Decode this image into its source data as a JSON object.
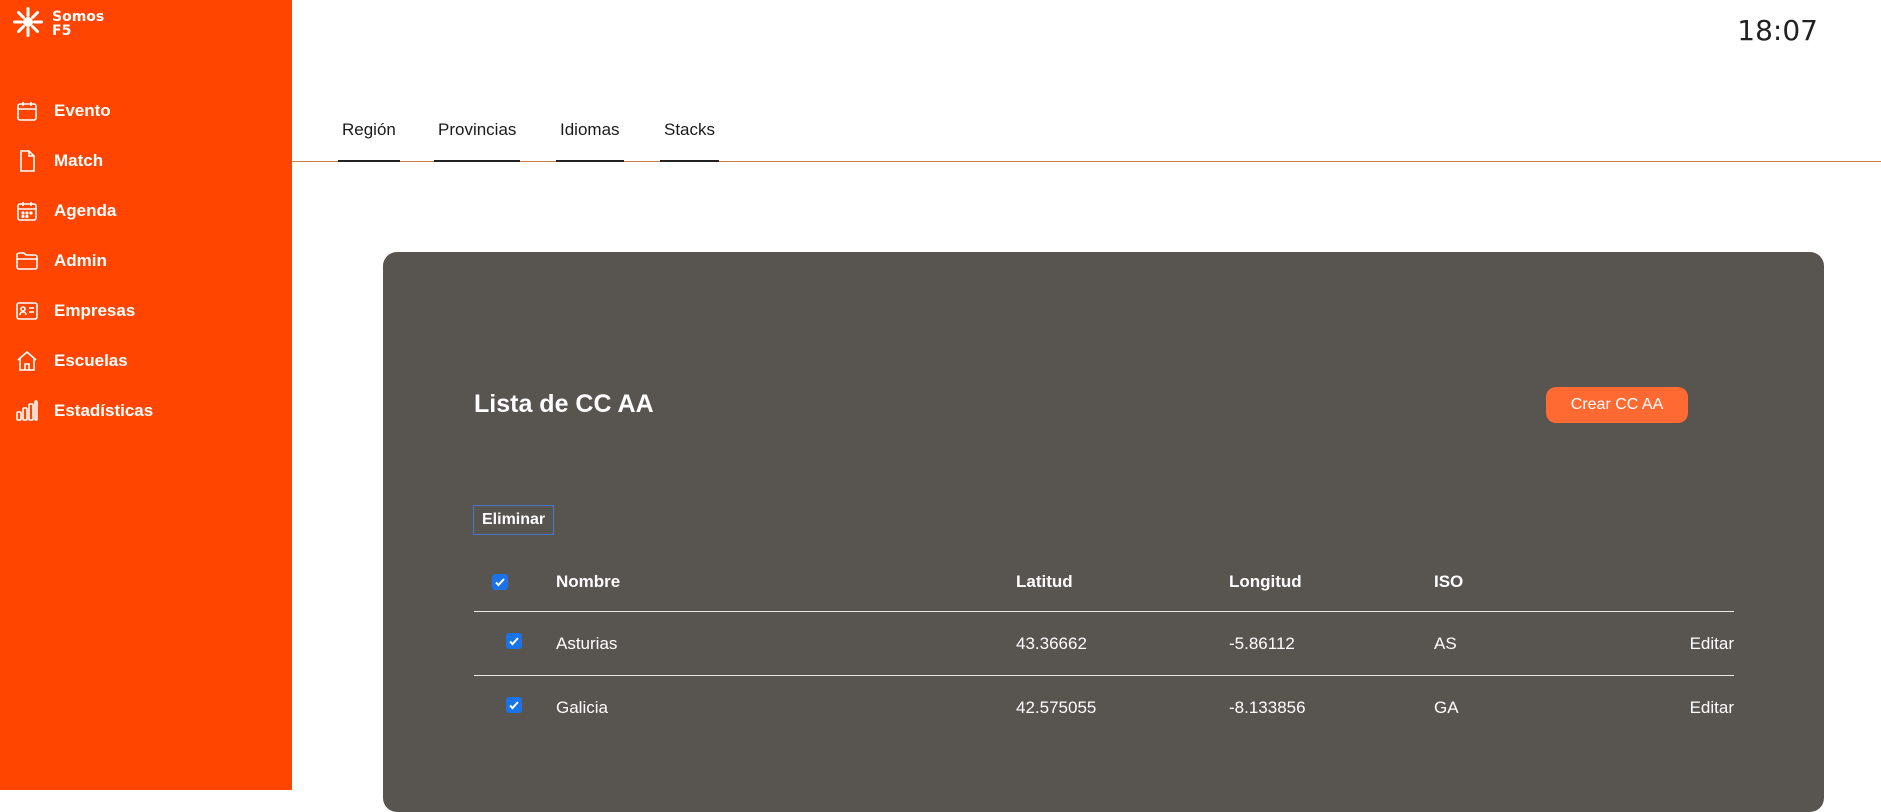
{
  "brand": {
    "line1": "Somos",
    "line2": "F5"
  },
  "sidebar": {
    "items": [
      {
        "label": "Evento",
        "icon": "calendar-icon"
      },
      {
        "label": "Match",
        "icon": "file-icon"
      },
      {
        "label": "Agenda",
        "icon": "calendar-grid-icon"
      },
      {
        "label": "Admin",
        "icon": "folder-icon"
      },
      {
        "label": "Empresas",
        "icon": "id-card-icon"
      },
      {
        "label": "Escuelas",
        "icon": "home-icon"
      },
      {
        "label": "Estadísticas",
        "icon": "bar-chart-icon"
      }
    ]
  },
  "header": {
    "time": "18:07"
  },
  "tabs": [
    {
      "label": "Región"
    },
    {
      "label": "Provincias"
    },
    {
      "label": "Idiomas"
    },
    {
      "label": "Stacks"
    }
  ],
  "panel": {
    "title": "Lista de CC AA",
    "create_label": "Crear CC AA",
    "delete_label": "Eliminar"
  },
  "table": {
    "columns": [
      "Nombre",
      "Latitud",
      "Longitud",
      "ISO"
    ],
    "edit_label": "Editar",
    "rows": [
      {
        "name": "Asturias",
        "lat": "43.36662",
        "lon": "-5.86112",
        "iso": "AS",
        "checked": true
      },
      {
        "name": "Galicia",
        "lat": "42.575055",
        "lon": "-8.133856",
        "iso": "GA",
        "checked": true
      }
    ]
  },
  "colors": {
    "accent": "#ff4500",
    "panel": "#58544f",
    "button": "#ff6a33",
    "checkbox": "#1a73e8"
  }
}
